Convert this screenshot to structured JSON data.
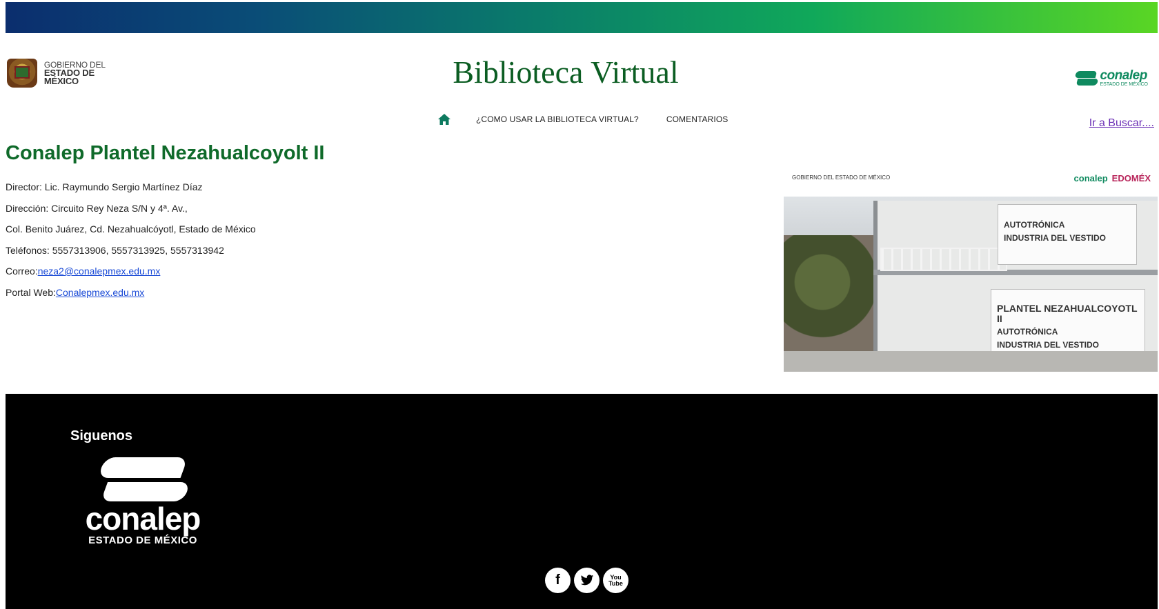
{
  "header": {
    "gov_logo_line1": "GOBIERNO DEL",
    "gov_logo_line2": "ESTADO DE MÉXICO",
    "title": "Biblioteca Virtual",
    "conalep_name": "conalep",
    "conalep_sub": "ESTADO DE MÉXICO"
  },
  "nav": {
    "home_icon": "home-icon",
    "items": [
      {
        "label": "¿COMO USAR LA BIBLIOTECA VIRTUAL?"
      },
      {
        "label": "COMENTARIOS"
      }
    ],
    "search_link": "Ir a Buscar...."
  },
  "plantel": {
    "name": "Conalep Plantel Nezahualcoyolt II",
    "director": "Director: Lic. Raymundo Sergio Martínez Díaz",
    "address1": "Dirección: Circuito Rey Neza S/N y 4ª. Av.,",
    "address2": "Col. Benito Juárez, Cd. Nezahualcóyotl, Estado de México",
    "phones": "Teléfonos: 5557313906, 5557313925, 5557313942",
    "email_label": "Correo:",
    "email": "neza2@conalepmex.edu.mx",
    "web_label": "Portal Web:",
    "web": "Conalepmex.edu.mx"
  },
  "photo": {
    "header_left": "GOBIERNO DEL ESTADO DE MÉXICO",
    "header_right": "conalep",
    "header_right2": "EDOMÉX",
    "sign1_line1": "AUTOTRÓNICA",
    "sign1_line2": "INDUSTRIA DEL VESTIDO",
    "sign2_title": "PLANTEL NEZAHUALCOYOTL II",
    "sign2_line1": "AUTOTRÓNICA",
    "sign2_line2": "INDUSTRIA DEL VESTIDO"
  },
  "footer": {
    "follow": "Siguenos",
    "logo_name": "conalep",
    "logo_sub": "ESTADO DE MÉXICO",
    "social": [
      {
        "icon": "facebook-icon",
        "glyph": "f"
      },
      {
        "icon": "twitter-icon",
        "glyph": ""
      },
      {
        "icon": "youtube-icon",
        "glyph": "You Tube"
      }
    ]
  },
  "colors": {
    "title_green": "#0b5d22",
    "heading_green": "#0f6a2a",
    "link_blue": "#1a4ad6",
    "visited_purple": "#6b2fb5",
    "brand_green": "#0f8a5f"
  }
}
